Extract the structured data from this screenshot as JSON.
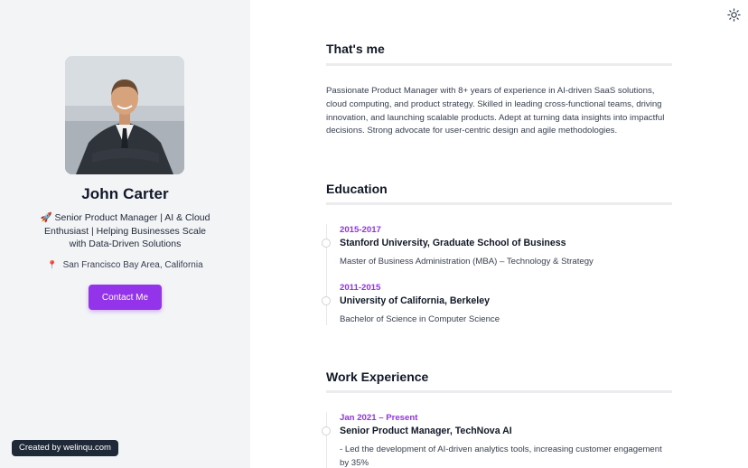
{
  "profile": {
    "name": "John Carter",
    "headline": "🚀 Senior Product Manager | AI & Cloud Enthusiast | Helping Businesses Scale with Data-Driven Solutions",
    "location_icon": "📍",
    "location": "San Francisco Bay Area, California",
    "contact_label": "Contact Me"
  },
  "credit": "Created by welinqu.com",
  "about": {
    "title": "That's me",
    "text": "Passionate Product Manager with 8+ years of experience in AI-driven SaaS solutions, cloud computing, and product strategy. Skilled in leading cross-functional teams, driving innovation, and launching scalable products. Adept at turning data insights into impactful decisions. Strong advocate for user-centric design and agile methodologies."
  },
  "education": {
    "title": "Education",
    "items": [
      {
        "date": "2015-2017",
        "school": "Stanford University, Graduate School of Business",
        "degree": "Master of Business Administration (MBA) – Technology & Strategy"
      },
      {
        "date": "2011-2015",
        "school": "University of California, Berkeley",
        "degree": "Bachelor of Science in Computer Science"
      }
    ]
  },
  "work": {
    "title": "Work Experience",
    "items": [
      {
        "date": "Jan 2021 – Present",
        "role": "Senior Product Manager, TechNova AI",
        "desc": "- Led the development of AI-driven analytics tools, increasing customer engagement by 35%"
      }
    ]
  },
  "icons": {
    "theme_toggle": "sun-icon",
    "location": "map-pin-icon"
  },
  "colors": {
    "accent": "#9333ea",
    "sidebar_bg": "#f3f4f6",
    "credit_bg": "#1f2937"
  }
}
